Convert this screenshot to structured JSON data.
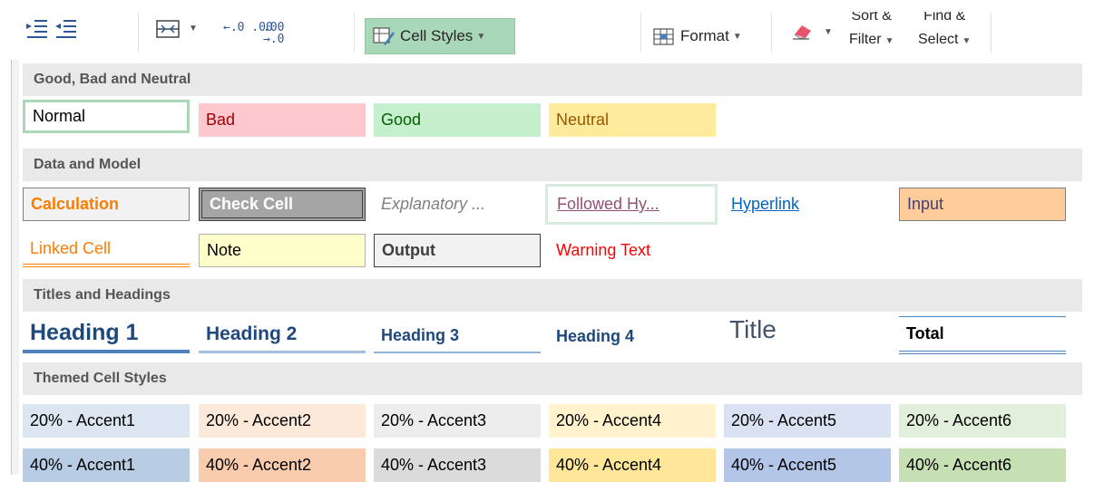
{
  "ribbon": {
    "cell_styles_label": "Cell Styles",
    "format_label": "Format",
    "sort_filter_line1": "Sort &",
    "sort_filter_line2": "Filter",
    "find_select_line1": "Find &",
    "find_select_line2": "Select",
    "increase_decimal_glyph": "←.0 .00",
    "decrease_decimal_glyph": ".00 →.0",
    "icons": [
      "increase-indent-icon",
      "decrease-indent-icon",
      "merge-center-icon",
      "increase-decimal-icon",
      "decrease-decimal-icon",
      "cell-styles-icon",
      "format-icon",
      "eraser-icon"
    ],
    "accent_color": "#a9d8b9"
  },
  "gallery": {
    "sections": [
      {
        "title": "Good, Bad and Neutral",
        "styles": [
          "Normal",
          "Bad",
          "Good",
          "Neutral"
        ]
      },
      {
        "title": "Data and Model",
        "rows": [
          [
            "Calculation",
            "Check Cell",
            "Explanatory ...",
            "Followed Hy...",
            "Hyperlink",
            "Input"
          ],
          [
            "Linked Cell",
            "Note",
            "Output",
            "Warning Text"
          ]
        ]
      },
      {
        "title": "Titles and Headings",
        "styles": [
          "Heading 1",
          "Heading 2",
          "Heading 3",
          "Heading 4",
          "Title",
          "Total"
        ]
      },
      {
        "title": "Themed Cell Styles",
        "rows": [
          [
            "20% - Accent1",
            "20% - Accent2",
            "20% - Accent3",
            "20% - Accent4",
            "20% - Accent5",
            "20% - Accent6"
          ],
          [
            "40% - Accent1",
            "40% - Accent2",
            "40% - Accent3",
            "40% - Accent4",
            "40% - Accent5",
            "40% - Accent6"
          ]
        ]
      }
    ],
    "colors": {
      "bad_fill": "#ffc7ce",
      "bad_text": "#9c0006",
      "good_fill": "#c6efce",
      "good_text": "#006100",
      "neutral_fill": "#ffeb9c",
      "neutral_text": "#9c5700",
      "selected_border": "#a9d8b9",
      "accent20": [
        "#dce6f1",
        "#fde9d9",
        "#ededed",
        "#fff2cc",
        "#d9e1f2",
        "#e2efda"
      ],
      "accent40": [
        "#b8cce4",
        "#f8cbad",
        "#dbdbdb",
        "#ffe699",
        "#b4c6e7",
        "#c6e0b4"
      ]
    }
  }
}
